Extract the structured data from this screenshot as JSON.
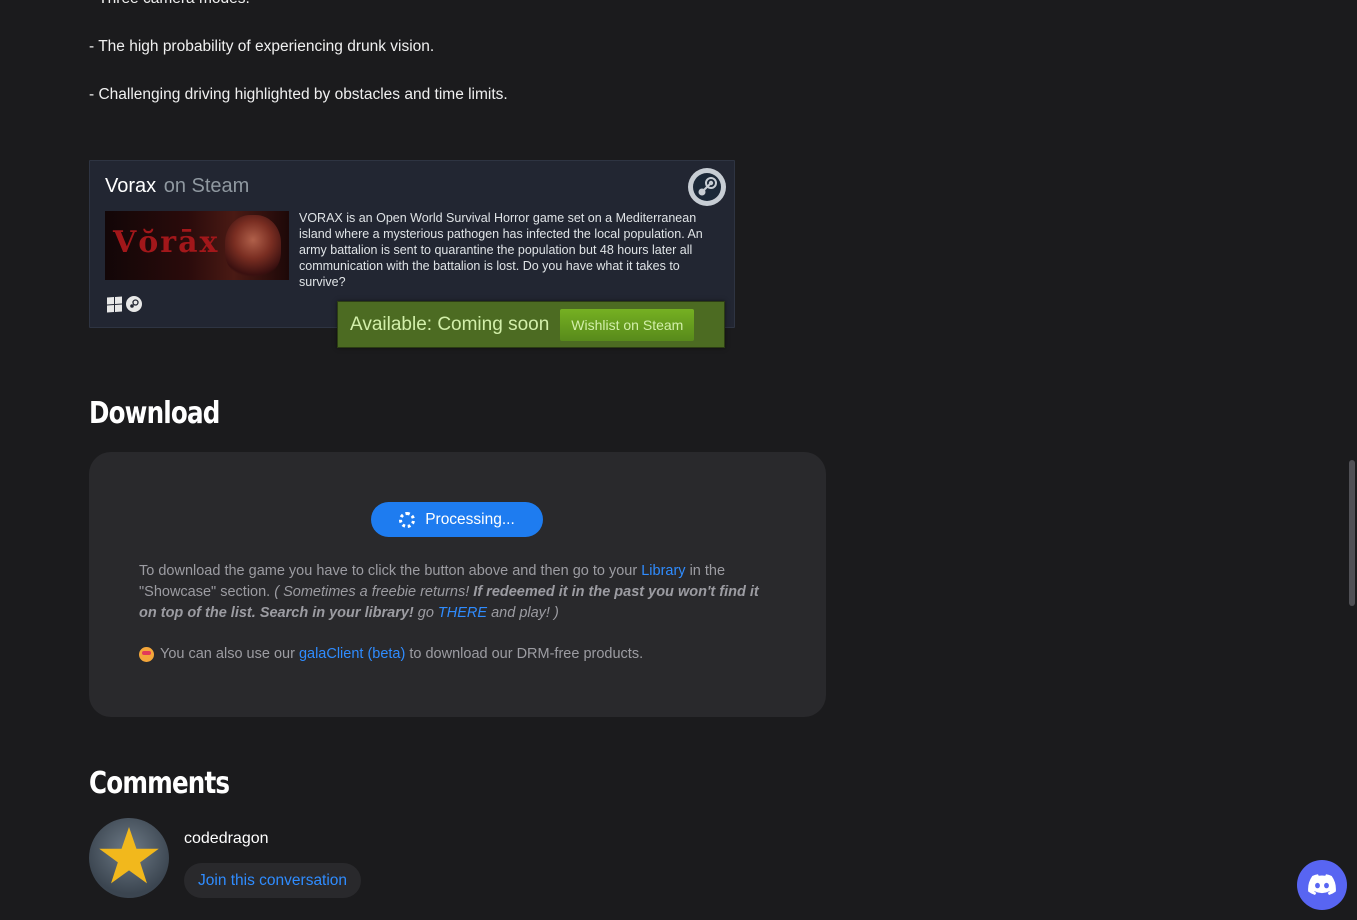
{
  "features": [
    "- Three camera modes.",
    "- The high probability of experiencing drunk vision.",
    "- Challenging driving highlighted by obstacles and time limits."
  ],
  "steam_widget": {
    "game_name": "Vorax",
    "on_steam": "on Steam",
    "capsule_text": "Vŏrāx",
    "description": "VORAX is an Open World Survival Horror game set on a Mediterranean island where a mysterious pathogen has infected the local population. An army battalion is sent to quarantine the population but 48 hours later all communication with the battalion is lost. Do you have what it takes to survive?",
    "availability": "Available: Coming soon",
    "wishlist_label": "Wishlist on Steam"
  },
  "download": {
    "heading": "Download",
    "button_label": "Processing...",
    "text_1": "To download the game you have to click the button above and then go to your ",
    "library_link": "Library",
    "text_2": " in the \"Showcase\" section. ",
    "italic_1": "( Sometimes a freebie returns! ",
    "bold_italic": "If redeemed it in the past you won't find it on top of the list. Search in your library!",
    "italic_2": " go ",
    "there_link": "THERE",
    "italic_3": " and play! )",
    "gala_text_1": "You can also use our ",
    "gala_link": "galaClient (beta)",
    "gala_text_2": " to download our DRM-free products."
  },
  "comments": {
    "heading": "Comments",
    "username": "codedragon",
    "join_label": "Join this conversation"
  },
  "colors": {
    "background": "#1b1b1d",
    "accent_blue": "#1e7cf0",
    "steam_green": "#75b022",
    "discord": "#5865f2"
  }
}
